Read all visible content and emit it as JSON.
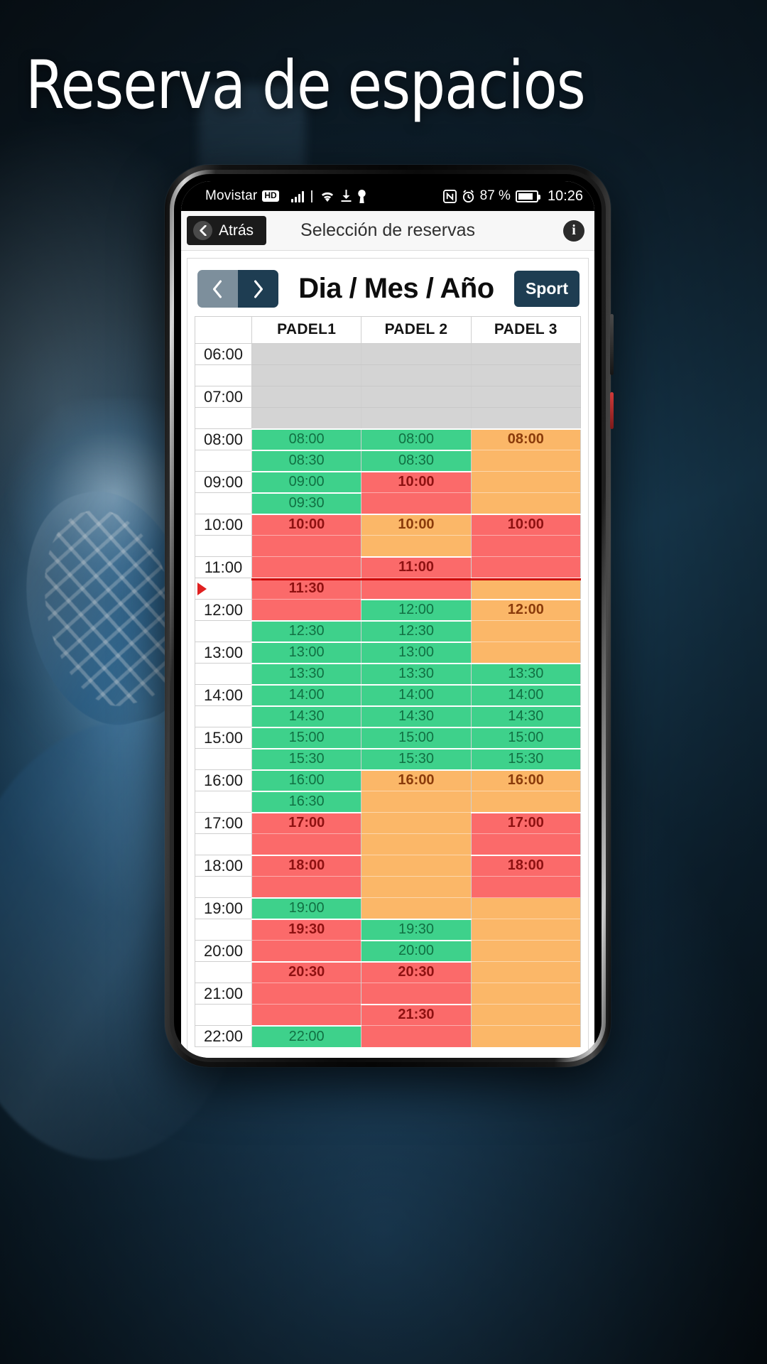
{
  "poster": {
    "title": "Reserva de espacios"
  },
  "status_bar": {
    "carrier": "Movistar",
    "network_badge": "HD",
    "battery_percent": "87 %",
    "time": "10:26",
    "icons": [
      "signal-bars-icon",
      "wifi-icon",
      "download-icon",
      "vpn-key-icon",
      "nfc-icon",
      "alarm-icon",
      "battery-icon"
    ]
  },
  "app_header": {
    "back_label": "Atrás",
    "title": "Selección de reservas",
    "info_label": "i"
  },
  "date_bar": {
    "prev_label": "‹",
    "next_label": "›",
    "date_label": "Dia / Mes / Año",
    "sport_label": "Sport"
  },
  "legend_colors": {
    "free": "#3ed18b",
    "busy": "#fb6a6a",
    "partial": "#fbb768",
    "closed": "#d4d4d4",
    "now_marker": "#cc0000",
    "accent_dark": "#1e3d52",
    "accent_light": "#7d8f9c"
  },
  "grid": {
    "columns": [
      "",
      "PADEL1",
      "PADEL 2",
      "PADEL 3"
    ],
    "now_time": "11:30",
    "rows": [
      {
        "time": "06:00",
        "slots": [
          {
            "state": "closed",
            "label": "",
            "start": true
          },
          {
            "state": "closed",
            "label": "",
            "start": true
          },
          {
            "state": "closed",
            "label": "",
            "start": true
          }
        ]
      },
      {
        "time": "",
        "slots": [
          {
            "state": "closed",
            "label": "",
            "start": false
          },
          {
            "state": "closed",
            "label": "",
            "start": false
          },
          {
            "state": "closed",
            "label": "",
            "start": false
          }
        ]
      },
      {
        "time": "07:00",
        "slots": [
          {
            "state": "closed",
            "label": "",
            "start": false
          },
          {
            "state": "closed",
            "label": "",
            "start": false
          },
          {
            "state": "closed",
            "label": "",
            "start": false
          }
        ]
      },
      {
        "time": "",
        "slots": [
          {
            "state": "closed",
            "label": "",
            "start": false
          },
          {
            "state": "closed",
            "label": "",
            "start": false
          },
          {
            "state": "closed",
            "label": "",
            "start": false
          }
        ]
      },
      {
        "time": "08:00",
        "slots": [
          {
            "state": "free",
            "label": "08:00",
            "start": true
          },
          {
            "state": "free",
            "label": "08:00",
            "start": true
          },
          {
            "state": "partial",
            "label": "08:00",
            "start": true
          }
        ]
      },
      {
        "time": "",
        "slots": [
          {
            "state": "free",
            "label": "08:30",
            "start": true
          },
          {
            "state": "free",
            "label": "08:30",
            "start": true
          },
          {
            "state": "partial",
            "label": "",
            "start": false
          }
        ]
      },
      {
        "time": "09:00",
        "slots": [
          {
            "state": "free",
            "label": "09:00",
            "start": true
          },
          {
            "state": "busy",
            "label": "10:00",
            "start": true
          },
          {
            "state": "partial",
            "label": "",
            "start": false
          }
        ]
      },
      {
        "time": "",
        "slots": [
          {
            "state": "free",
            "label": "09:30",
            "start": true
          },
          {
            "state": "busy",
            "label": "",
            "start": false
          },
          {
            "state": "partial",
            "label": "",
            "start": false
          }
        ]
      },
      {
        "time": "10:00",
        "slots": [
          {
            "state": "busy",
            "label": "10:00",
            "start": true
          },
          {
            "state": "partial",
            "label": "10:00",
            "start": true
          },
          {
            "state": "busy",
            "label": "10:00",
            "start": true
          }
        ]
      },
      {
        "time": "",
        "slots": [
          {
            "state": "busy",
            "label": "",
            "start": false
          },
          {
            "state": "partial",
            "label": "",
            "start": false
          },
          {
            "state": "busy",
            "label": "",
            "start": false
          }
        ]
      },
      {
        "time": "11:00",
        "slots": [
          {
            "state": "busy",
            "label": "",
            "start": false
          },
          {
            "state": "busy",
            "label": "11:00",
            "start": true
          },
          {
            "state": "busy",
            "label": "",
            "start": false
          }
        ]
      },
      {
        "time": "",
        "now": true,
        "slots": [
          {
            "state": "busy",
            "label": "11:30",
            "start": true
          },
          {
            "state": "busy",
            "label": "",
            "start": false
          },
          {
            "state": "partial",
            "label": "",
            "start": true
          }
        ]
      },
      {
        "time": "12:00",
        "slots": [
          {
            "state": "busy",
            "label": "",
            "start": false
          },
          {
            "state": "free",
            "label": "12:00",
            "start": true
          },
          {
            "state": "partial",
            "label": "12:00",
            "start": true
          }
        ]
      },
      {
        "time": "",
        "slots": [
          {
            "state": "free",
            "label": "12:30",
            "start": true
          },
          {
            "state": "free",
            "label": "12:30",
            "start": true
          },
          {
            "state": "partial",
            "label": "",
            "start": false
          }
        ]
      },
      {
        "time": "13:00",
        "slots": [
          {
            "state": "free",
            "label": "13:00",
            "start": true
          },
          {
            "state": "free",
            "label": "13:00",
            "start": true
          },
          {
            "state": "partial",
            "label": "",
            "start": false
          }
        ]
      },
      {
        "time": "",
        "slots": [
          {
            "state": "free",
            "label": "13:30",
            "start": true
          },
          {
            "state": "free",
            "label": "13:30",
            "start": true
          },
          {
            "state": "free",
            "label": "13:30",
            "start": true
          }
        ]
      },
      {
        "time": "14:00",
        "slots": [
          {
            "state": "free",
            "label": "14:00",
            "start": true
          },
          {
            "state": "free",
            "label": "14:00",
            "start": true
          },
          {
            "state": "free",
            "label": "14:00",
            "start": true
          }
        ]
      },
      {
        "time": "",
        "slots": [
          {
            "state": "free",
            "label": "14:30",
            "start": true
          },
          {
            "state": "free",
            "label": "14:30",
            "start": true
          },
          {
            "state": "free",
            "label": "14:30",
            "start": true
          }
        ]
      },
      {
        "time": "15:00",
        "slots": [
          {
            "state": "free",
            "label": "15:00",
            "start": true
          },
          {
            "state": "free",
            "label": "15:00",
            "start": true
          },
          {
            "state": "free",
            "label": "15:00",
            "start": true
          }
        ]
      },
      {
        "time": "",
        "slots": [
          {
            "state": "free",
            "label": "15:30",
            "start": true
          },
          {
            "state": "free",
            "label": "15:30",
            "start": true
          },
          {
            "state": "free",
            "label": "15:30",
            "start": true
          }
        ]
      },
      {
        "time": "16:00",
        "slots": [
          {
            "state": "free",
            "label": "16:00",
            "start": true
          },
          {
            "state": "partial",
            "label": "16:00",
            "start": true
          },
          {
            "state": "partial",
            "label": "16:00",
            "start": true
          }
        ]
      },
      {
        "time": "",
        "slots": [
          {
            "state": "free",
            "label": "16:30",
            "start": true
          },
          {
            "state": "partial",
            "label": "",
            "start": false
          },
          {
            "state": "partial",
            "label": "",
            "start": false
          }
        ]
      },
      {
        "time": "17:00",
        "slots": [
          {
            "state": "busy",
            "label": "17:00",
            "start": true
          },
          {
            "state": "partial",
            "label": "",
            "start": false
          },
          {
            "state": "busy",
            "label": "17:00",
            "start": true
          }
        ]
      },
      {
        "time": "",
        "slots": [
          {
            "state": "busy",
            "label": "",
            "start": false
          },
          {
            "state": "partial",
            "label": "",
            "start": false
          },
          {
            "state": "busy",
            "label": "",
            "start": false
          }
        ]
      },
      {
        "time": "18:00",
        "slots": [
          {
            "state": "busy",
            "label": "18:00",
            "start": true
          },
          {
            "state": "partial",
            "label": "",
            "start": false
          },
          {
            "state": "busy",
            "label": "18:00",
            "start": true
          }
        ]
      },
      {
        "time": "",
        "slots": [
          {
            "state": "busy",
            "label": "",
            "start": false
          },
          {
            "state": "partial",
            "label": "",
            "start": false
          },
          {
            "state": "busy",
            "label": "",
            "start": false
          }
        ]
      },
      {
        "time": "19:00",
        "slots": [
          {
            "state": "free",
            "label": "19:00",
            "start": true
          },
          {
            "state": "partial",
            "label": "",
            "start": false
          },
          {
            "state": "partial",
            "label": "",
            "start": false
          }
        ]
      },
      {
        "time": "",
        "slots": [
          {
            "state": "busy",
            "label": "19:30",
            "start": true
          },
          {
            "state": "free",
            "label": "19:30",
            "start": true
          },
          {
            "state": "partial",
            "label": "",
            "start": false
          }
        ]
      },
      {
        "time": "20:00",
        "slots": [
          {
            "state": "busy",
            "label": "",
            "start": false
          },
          {
            "state": "free",
            "label": "20:00",
            "start": true
          },
          {
            "state": "partial",
            "label": "",
            "start": false
          }
        ]
      },
      {
        "time": "",
        "slots": [
          {
            "state": "busy",
            "label": "20:30",
            "start": true
          },
          {
            "state": "busy",
            "label": "20:30",
            "start": true
          },
          {
            "state": "partial",
            "label": "",
            "start": false
          }
        ]
      },
      {
        "time": "21:00",
        "slots": [
          {
            "state": "busy",
            "label": "",
            "start": false
          },
          {
            "state": "busy",
            "label": "",
            "start": false
          },
          {
            "state": "partial",
            "label": "",
            "start": false
          }
        ]
      },
      {
        "time": "",
        "slots": [
          {
            "state": "busy",
            "label": "",
            "start": false
          },
          {
            "state": "busy",
            "label": "21:30",
            "start": true
          },
          {
            "state": "partial",
            "label": "",
            "start": false
          }
        ]
      },
      {
        "time": "22:00",
        "slots": [
          {
            "state": "free",
            "label": "22:00",
            "start": true
          },
          {
            "state": "busy",
            "label": "",
            "start": false
          },
          {
            "state": "partial",
            "label": "",
            "start": false
          }
        ]
      }
    ]
  }
}
